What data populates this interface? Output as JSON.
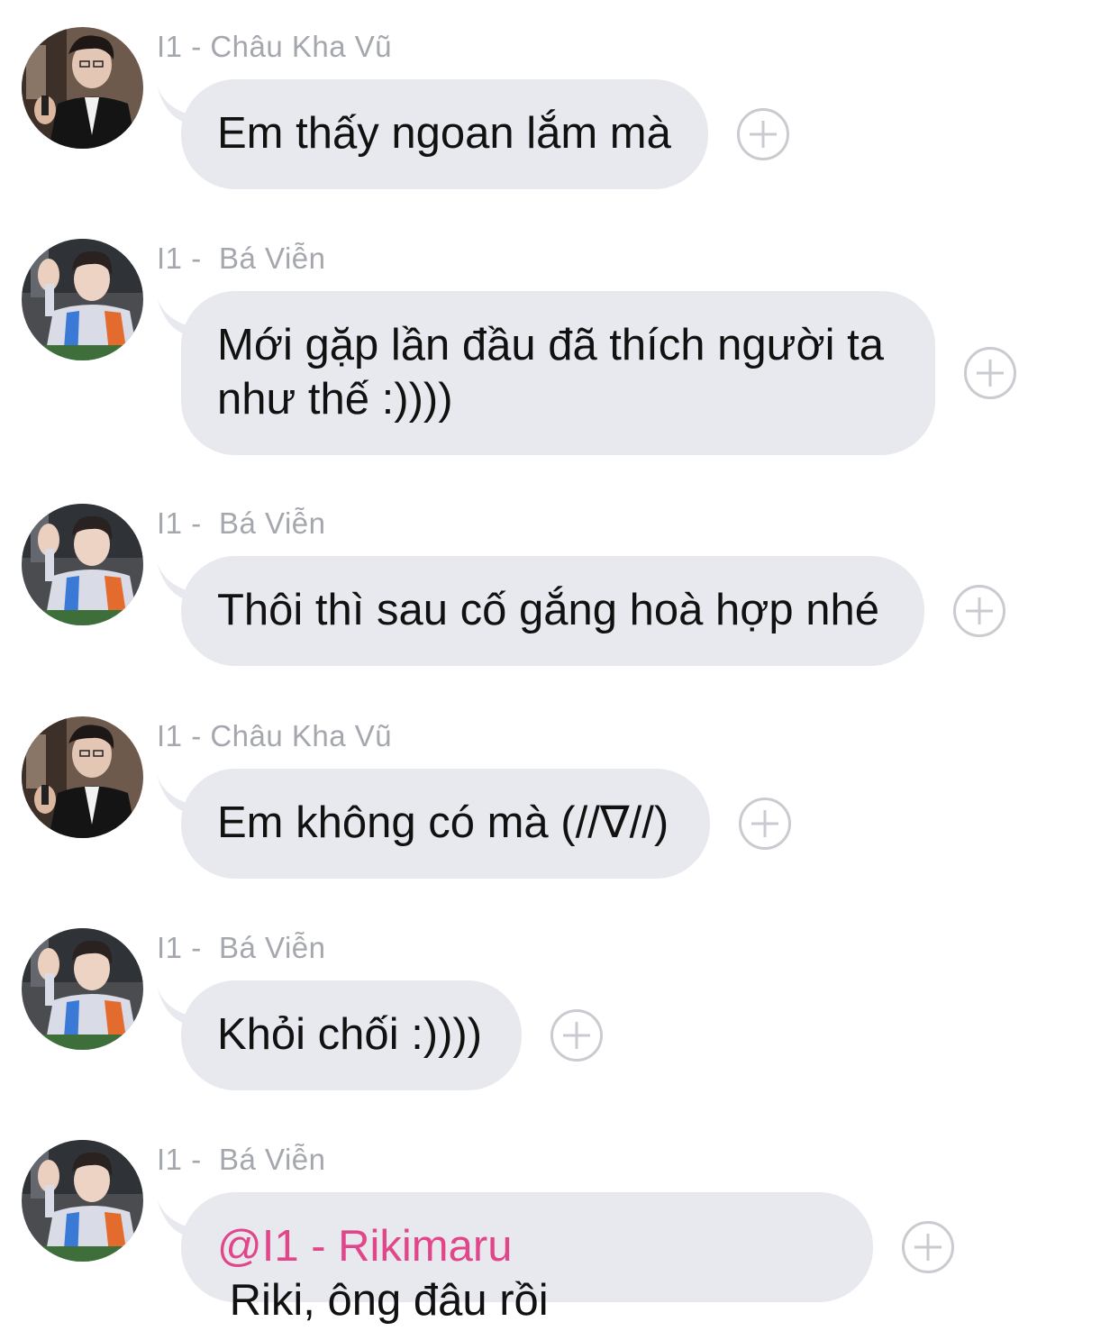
{
  "messages": [
    {
      "avatar": "avatar-chau-kha-vu",
      "sender": "I1 - Châu Kha Vũ",
      "text": "Em thấy ngoan lắm mà",
      "react_icon": "add-reaction-icon"
    },
    {
      "avatar": "avatar-ba-vien",
      "sender": "I1 -  Bá Viễn",
      "text_line1": "Mới gặp lần đầu đã thích người ta",
      "text_line2": "như thế :))))",
      "react_icon": "add-reaction-icon"
    },
    {
      "avatar": "avatar-ba-vien",
      "sender": "I1 -  Bá Viễn",
      "text": "Thôi thì sau cố gắng hoà hợp nhé",
      "react_icon": "add-reaction-icon"
    },
    {
      "avatar": "avatar-chau-kha-vu",
      "sender": "I1 - Châu Kha Vũ",
      "text": "Em không có mà (//∇//)",
      "react_icon": "add-reaction-icon"
    },
    {
      "avatar": "avatar-ba-vien",
      "sender": "I1 -  Bá Viễn",
      "text": "Khỏi chối :))))",
      "react_icon": "add-reaction-icon"
    },
    {
      "avatar": "avatar-ba-vien",
      "sender": "I1 -  Bá Viễn",
      "mention": "@I1 - Rikimaru",
      "text": " Riki, ông đâu rồi",
      "react_icon": "add-reaction-icon"
    }
  ],
  "colors": {
    "bubble": "#e8e9ee",
    "sender": "#a4a7ad",
    "mention": "#e2468a",
    "add_button": "#c9cbd0"
  }
}
